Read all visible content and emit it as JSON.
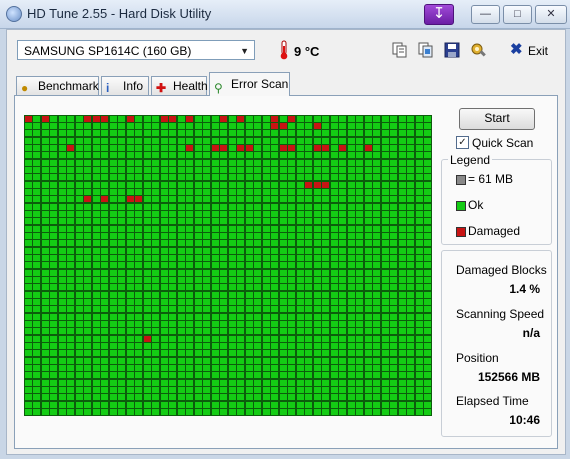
{
  "window": {
    "title": "HD Tune 2.55 - Hard Disk Utility"
  },
  "toolbar": {
    "drive": "SAMSUNG SP1614C (160 GB)",
    "temperature": "9 °C",
    "exit_label": "Exit",
    "icons": [
      "copy-text-icon",
      "copy-screenshot-icon",
      "save-icon",
      "options-icon"
    ]
  },
  "tabs": [
    {
      "label": "Benchmark",
      "icon": "lightbulb-icon"
    },
    {
      "label": "Info",
      "icon": "info-icon"
    },
    {
      "label": "Health",
      "icon": "health-cross-icon"
    },
    {
      "label": "Error Scan",
      "icon": "magnifier-icon",
      "active": true
    }
  ],
  "scan": {
    "start_label": "Start",
    "quick_scan_label": "Quick Scan",
    "quick_scan_checked": true,
    "grid_columns": 48,
    "grid_rows": 41,
    "damaged_cells": [
      [
        0,
        0
      ],
      [
        0,
        2
      ],
      [
        0,
        7
      ],
      [
        0,
        8
      ],
      [
        0,
        9
      ],
      [
        0,
        12
      ],
      [
        0,
        16
      ],
      [
        0,
        17
      ],
      [
        0,
        19
      ],
      [
        0,
        23
      ],
      [
        0,
        25
      ],
      [
        0,
        29
      ],
      [
        0,
        31
      ],
      [
        1,
        29
      ],
      [
        1,
        30
      ],
      [
        1,
        34
      ],
      [
        4,
        5
      ],
      [
        4,
        19
      ],
      [
        4,
        22
      ],
      [
        4,
        23
      ],
      [
        4,
        25
      ],
      [
        4,
        26
      ],
      [
        4,
        30
      ],
      [
        4,
        31
      ],
      [
        4,
        34
      ],
      [
        4,
        35
      ],
      [
        4,
        37
      ],
      [
        4,
        40
      ],
      [
        9,
        33
      ],
      [
        9,
        34
      ],
      [
        9,
        35
      ],
      [
        11,
        7
      ],
      [
        11,
        9
      ],
      [
        11,
        12
      ],
      [
        11,
        13
      ],
      [
        30,
        14
      ]
    ]
  },
  "legend": {
    "title": "Legend",
    "items": [
      {
        "label": "= 61 MB",
        "color": "#888888"
      },
      {
        "label": "Ok",
        "color": "#14cc14"
      },
      {
        "label": "Damaged",
        "color": "#c81414"
      }
    ]
  },
  "stats": [
    {
      "label": "Damaged Blocks",
      "value": "1.4 %"
    },
    {
      "label": "Scanning Speed",
      "value": "n/a"
    },
    {
      "label": "Position",
      "value": "152566 MB"
    },
    {
      "label": "Elapsed Time",
      "value": "10:46"
    }
  ]
}
